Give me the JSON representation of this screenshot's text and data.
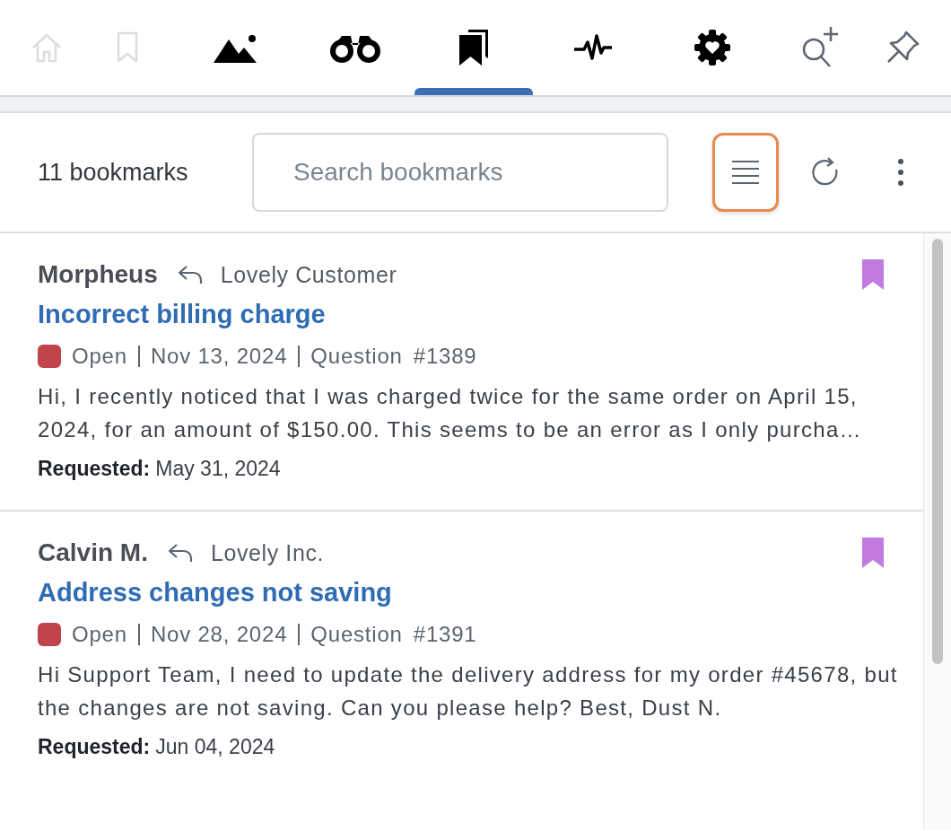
{
  "toolbar": {
    "tabs": [
      {
        "kind": "home",
        "disabled": true,
        "selected": false
      },
      {
        "kind": "bookmark",
        "disabled": true,
        "selected": false
      },
      {
        "kind": "image",
        "disabled": false,
        "selected": false
      },
      {
        "kind": "binoculars",
        "disabled": false,
        "selected": false
      },
      {
        "kind": "bookmarks",
        "disabled": false,
        "selected": true
      },
      {
        "kind": "activity",
        "disabled": false,
        "selected": false
      },
      {
        "kind": "gear",
        "disabled": false,
        "selected": false
      },
      {
        "kind": "search-plus",
        "disabled": false,
        "selected": false
      },
      {
        "kind": "pin",
        "disabled": false,
        "selected": false
      }
    ]
  },
  "header": {
    "count": "11 bookmarks",
    "search": {
      "placeholder": "Search bookmarks"
    },
    "list_view_focused": true
  },
  "bookmarks": [
    {
      "name": "Morpheus",
      "company": "Lovely Customer",
      "title": "Incorrect billing charge",
      "color": "#c0444a",
      "status": "Open",
      "date": "Nov 13, 2024",
      "type": "Question",
      "number": "#1389",
      "description": "Hi, I recently noticed that I was charged twice for the same order on April 15, 2024, for an amount of $150.00. This seems to be an error as I only purcha…",
      "requested_label": "Requested:",
      "requested_date": "May 31, 2024",
      "bookmarked": true
    },
    {
      "name": "Calvin M.",
      "company": "Lovely Inc.",
      "title": "Address changes not saving",
      "color": "#c0444a",
      "status": "Open",
      "date": "Nov 28, 2024",
      "type": "Question",
      "number": "#1391",
      "description": "Hi Support Team, I need to update the delivery address for my order #45678, but the changes are not saving. Can you please help? Best, Dust N.",
      "requested_label": "Requested:",
      "requested_date": "Jun 04, 2024",
      "bookmarked": true
    }
  ]
}
